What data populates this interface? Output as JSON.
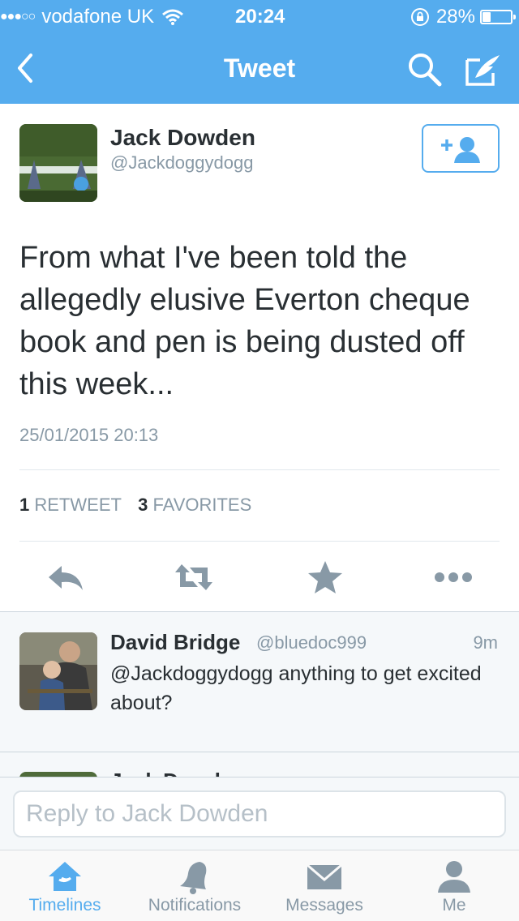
{
  "status_bar": {
    "signal_dots": "●●●○○",
    "carrier": "vodafone UK",
    "time": "20:24",
    "battery": "28%",
    "battery_level": 0.28
  },
  "nav": {
    "title": "Tweet",
    "icons": [
      "chevron-left-icon",
      "search-icon",
      "compose-icon"
    ]
  },
  "tweet": {
    "author_name": "Jack Dowden",
    "author_handle": "@Jackdoggydogg",
    "text": "From what I've been told the allegedly elusive Everton cheque book and pen is being dusted off this week...",
    "timestamp": "25/01/2015 20:13",
    "retweet_count": "1",
    "retweet_label": "RETWEET",
    "favorite_count": "3",
    "favorite_label": "FAVORITES",
    "actions": [
      "reply-icon",
      "retweet-icon",
      "star-icon",
      "more-icon"
    ]
  },
  "reply": {
    "author_name": "David Bridge",
    "author_handle": "@bluedoc999",
    "time": "9m",
    "text": "@Jackdoggydogg anything to get excited about?"
  },
  "next_reply": {
    "author_name": "Jack Dowden"
  },
  "composer": {
    "placeholder": "Reply to Jack Dowden"
  },
  "tabs": [
    {
      "label": "Timelines",
      "icon": "home-icon",
      "active": true
    },
    {
      "label": "Notifications",
      "icon": "bell-icon",
      "active": false
    },
    {
      "label": "Messages",
      "icon": "envelope-icon",
      "active": false
    },
    {
      "label": "Me",
      "icon": "person-icon",
      "active": false
    }
  ],
  "colors": {
    "accent": "#55acee",
    "text": "#292f33",
    "muted": "#8899a6"
  }
}
